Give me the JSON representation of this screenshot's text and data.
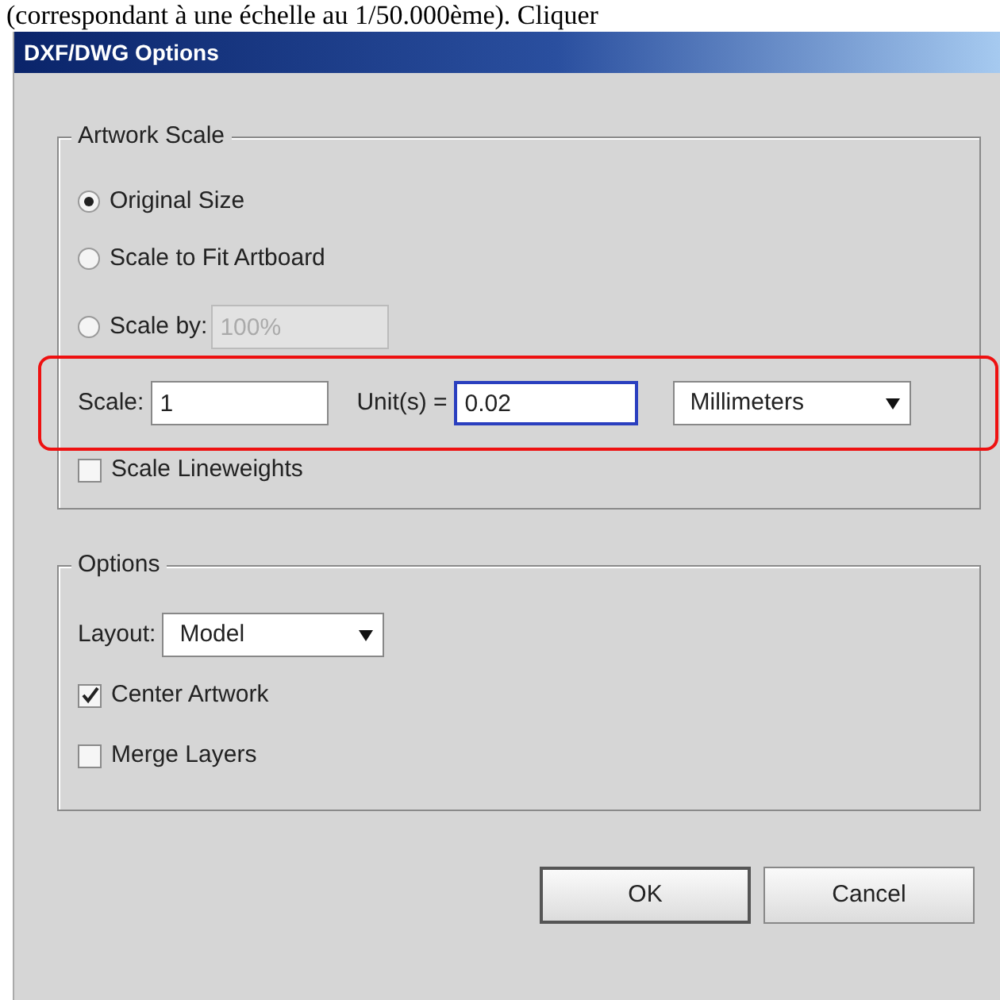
{
  "caption": "(correspondant à une échelle au 1/50.000ème). Cliquer",
  "window": {
    "title": "DXF/DWG Options"
  },
  "artwork_scale": {
    "title": "Artwork Scale",
    "options": [
      {
        "label": "Original Size",
        "selected": true
      },
      {
        "label": "Scale to Fit Artboard",
        "selected": false
      },
      {
        "label": "Scale by:",
        "selected": false,
        "field": {
          "value": "100%",
          "disabled": true
        }
      }
    ],
    "scale_row": {
      "highlighted": true,
      "scale_label": "Scale:",
      "scale_value": "1",
      "unit_label": "Unit(s) =",
      "unit_value": "0.02",
      "unit_focused": true,
      "units": "Millimeters"
    },
    "scale_lineweights": {
      "label": "Scale Lineweights",
      "checked": false
    }
  },
  "options": {
    "title": "Options",
    "layout_label": "Layout:",
    "layout": "Model",
    "checkboxes": [
      {
        "label": "Center Artwork",
        "checked": true
      },
      {
        "label": "Merge Layers",
        "checked": false
      }
    ]
  },
  "buttons": [
    {
      "label": "OK",
      "default": true
    },
    {
      "label": "Cancel",
      "default": false
    }
  ]
}
